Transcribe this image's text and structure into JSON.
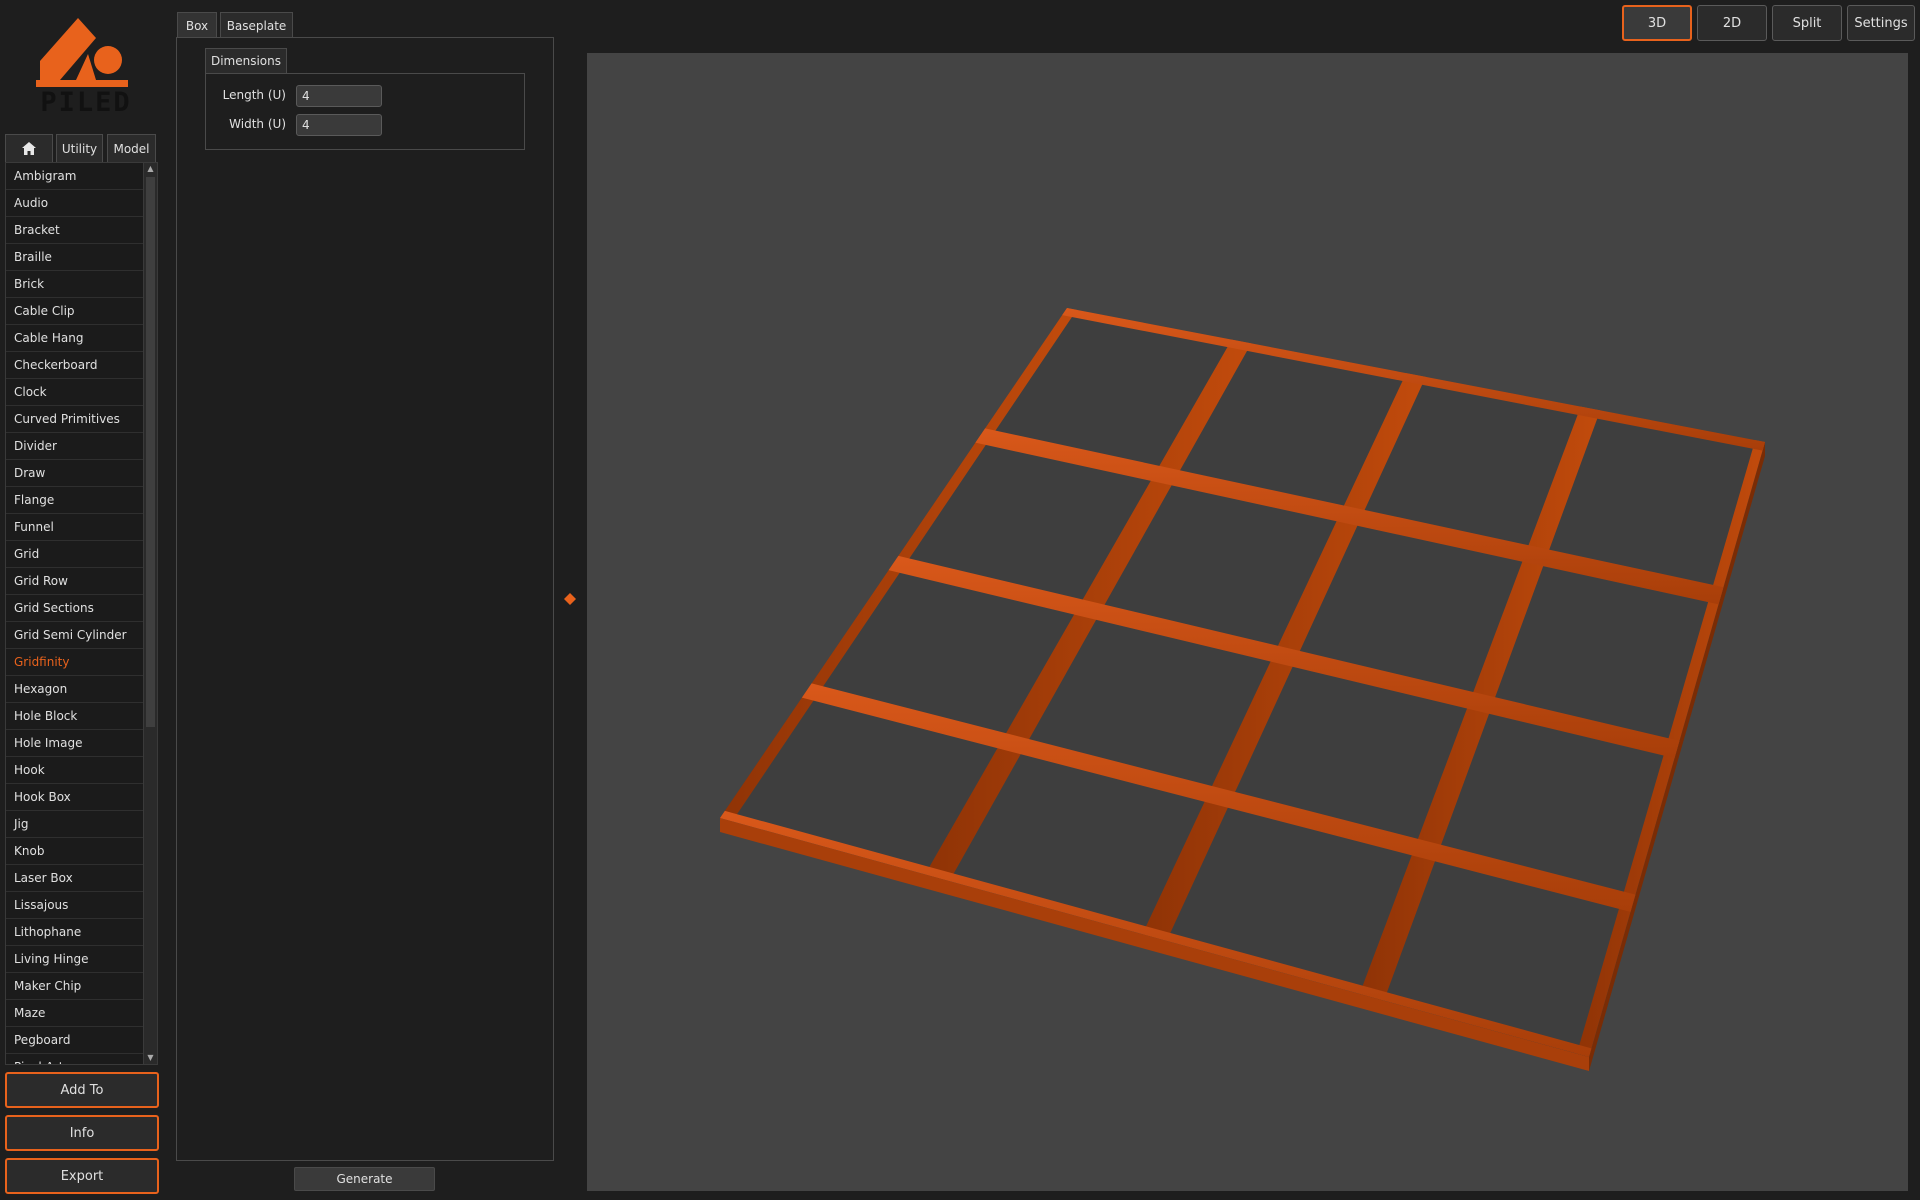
{
  "app": {
    "logo_text": "PILED",
    "accent_color": "#e8621c"
  },
  "category_tabs": [
    {
      "icon": "home-icon"
    },
    {
      "label": "Utility"
    },
    {
      "label": "Model"
    }
  ],
  "categories": [
    "Ambigram",
    "Audio",
    "Bracket",
    "Braille",
    "Brick",
    "Cable Clip",
    "Cable Hang",
    "Checkerboard",
    "Clock",
    "Curved Primitives",
    "Divider",
    "Draw",
    "Flange",
    "Funnel",
    "Grid",
    "Grid Row",
    "Grid Sections",
    "Grid Semi Cylinder",
    "Gridfinity",
    "Hexagon",
    "Hole Block",
    "Hole Image",
    "Hook",
    "Hook Box",
    "Jig",
    "Knob",
    "Laser Box",
    "Lissajous",
    "Lithophane",
    "Living Hinge",
    "Maker Chip",
    "Maze",
    "Pegboard",
    "Pixel Art"
  ],
  "selected_category": "Gridfinity",
  "actions": {
    "add_to": "Add To",
    "info": "Info",
    "export": "Export"
  },
  "params": {
    "tabs": [
      "Box",
      "Baseplate"
    ],
    "group_label": "Dimensions",
    "length_label": "Length (U)",
    "length_value": "4",
    "width_label": "Width (U)",
    "width_value": "4",
    "generate_label": "Generate"
  },
  "view": {
    "buttons": [
      "3D",
      "2D",
      "Split",
      "Settings"
    ],
    "active": "3D",
    "model": {
      "grid_cols": 4,
      "grid_rows": 4,
      "color": "#c24b0c"
    }
  }
}
